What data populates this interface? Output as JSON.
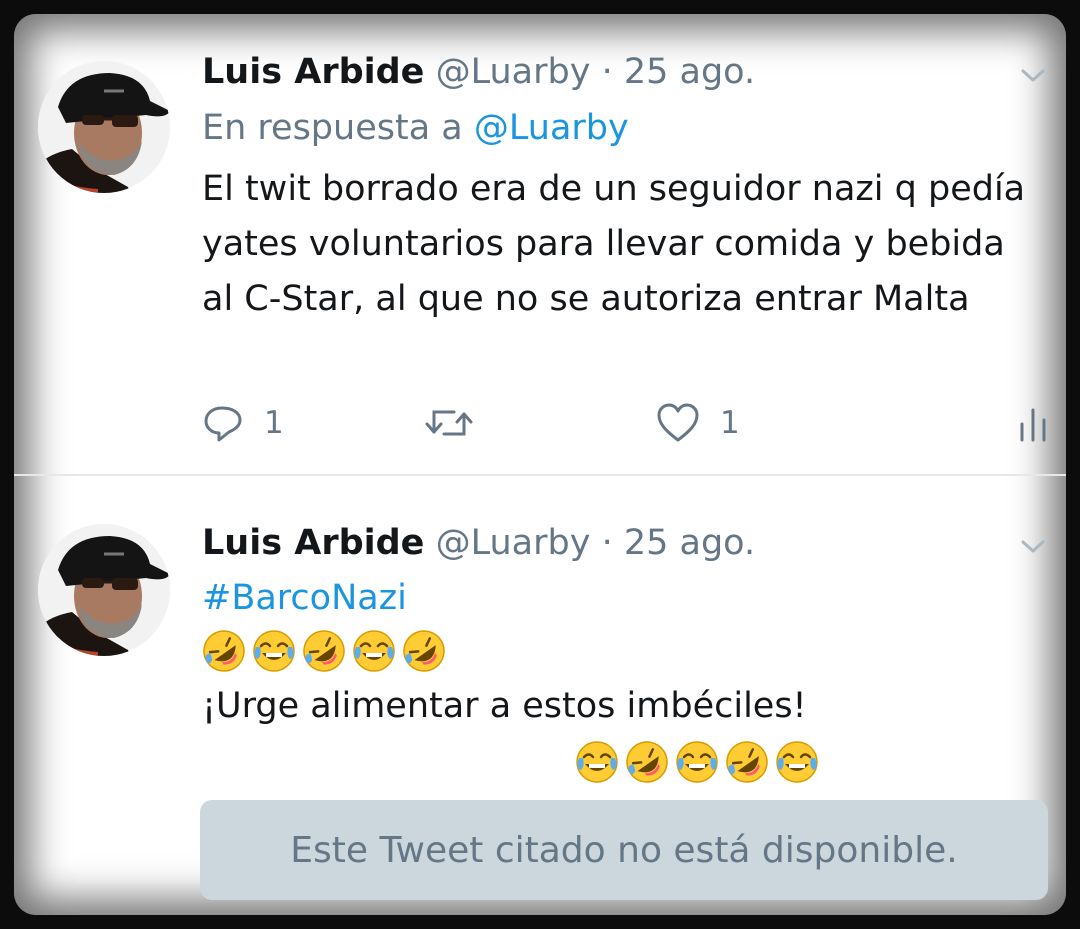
{
  "tweets": [
    {
      "author_name": "Luis Arbide",
      "handle": "@Luarby",
      "separator": "·",
      "date": "25 ago.",
      "reply_prefix": "En respuesta a",
      "reply_to": "@Luarby",
      "text": "El twit borrado era de un seguidor nazi q pedía yates voluntarios para llevar comida y bebida al C-Star, al que no se autoriza entrar Malta",
      "reply_count": "1",
      "like_count": "1"
    },
    {
      "author_name": "Luis Arbide",
      "handle": "@Luarby",
      "separator": "·",
      "date": "25 ago.",
      "hashtag": "#BarcoNazi",
      "emoji_line_1": [
        "rofl",
        "joy",
        "rofl",
        "joy",
        "rofl"
      ],
      "text_line": "¡Urge alimentar a estos imbéciles!",
      "emoji_line_2": [
        "joy",
        "rofl",
        "joy",
        "rofl",
        "joy"
      ],
      "quote_unavailable": "Este Tweet citado no está disponible."
    }
  ],
  "icons": {
    "menu": "chevron-down-icon",
    "reply": "reply-icon",
    "retweet": "retweet-icon",
    "like": "heart-icon",
    "analytics": "analytics-icon"
  },
  "colors": {
    "link": "#1b95e0",
    "secondary_text": "#657786",
    "primary_text": "#14171a",
    "quote_bg": "#ccd6dd"
  }
}
